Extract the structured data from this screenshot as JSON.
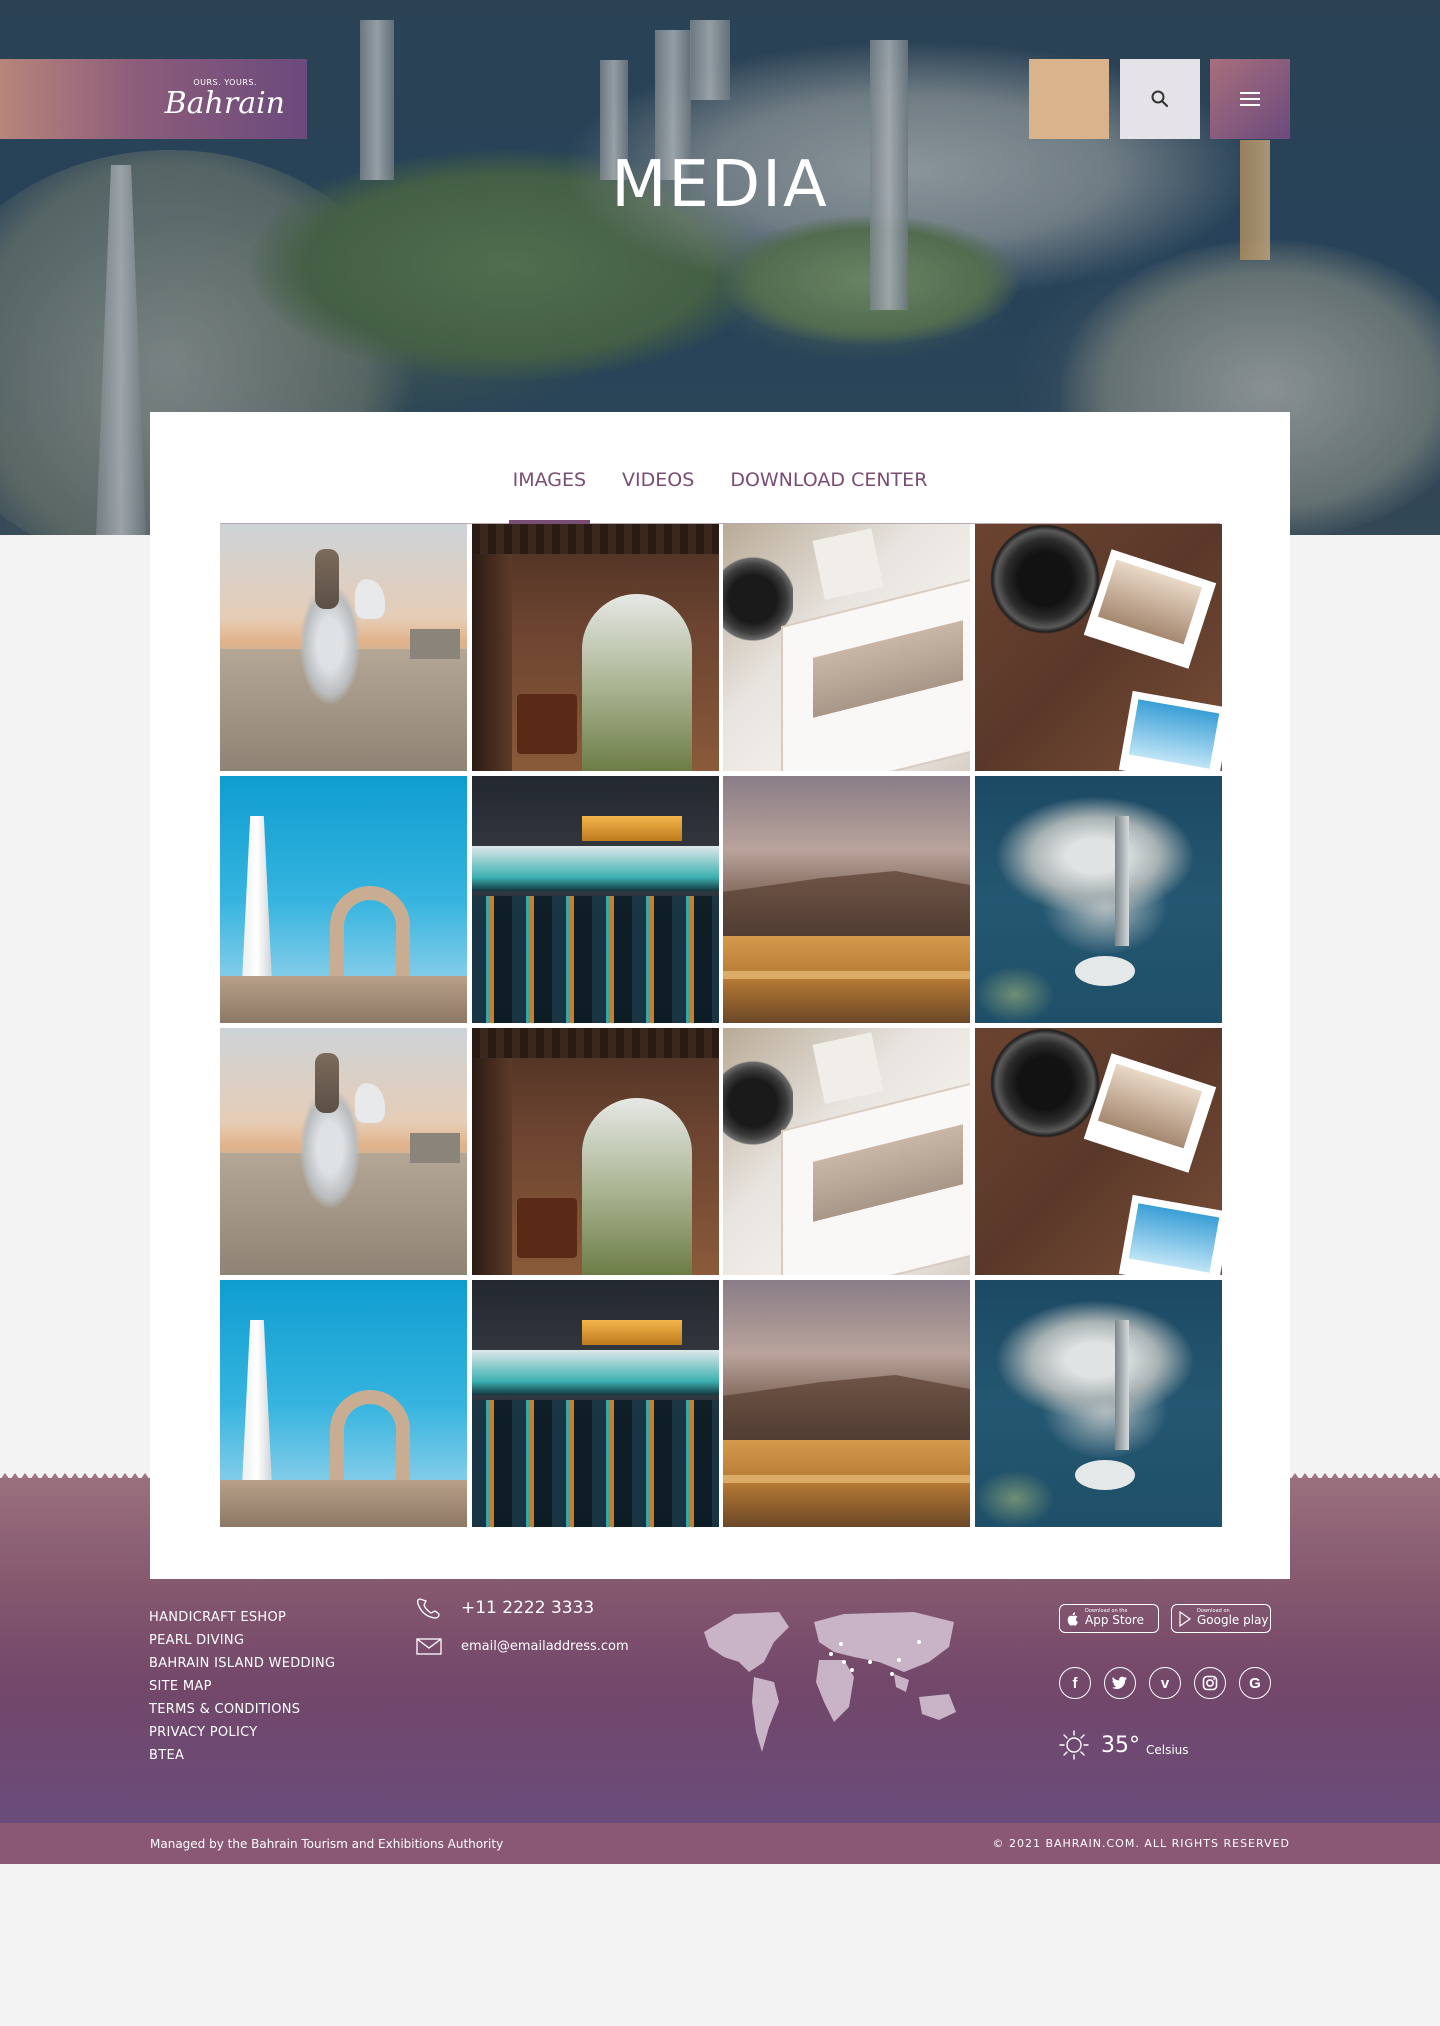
{
  "header": {
    "logo_tagline": "OURS. YOURS.",
    "logo_name": "Bahrain",
    "search_icon": "search-icon",
    "menu_icon": "menu-icon"
  },
  "hero": {
    "title": "MEDIA"
  },
  "tabs": [
    {
      "label": "IMAGES",
      "active": true
    },
    {
      "label": "VIDEOS",
      "active": false
    },
    {
      "label": "DOWNLOAD CENTER",
      "active": false
    }
  ],
  "gallery": [
    "horse-rider-beach",
    "arched-doorway",
    "camera-notebook",
    "camera-photographs",
    "minaret-ruins",
    "night-building-reflection",
    "fort-dusk",
    "aerial-city",
    "horse-rider-beach",
    "arched-doorway",
    "camera-notebook",
    "camera-photographs",
    "minaret-ruins",
    "night-building-reflection",
    "fort-dusk",
    "aerial-city"
  ],
  "footer": {
    "links": [
      "HANDICRAFT ESHOP",
      "PEARL DIVING",
      "BAHRAIN ISLAND WEDDING",
      "SITE MAP",
      "TERMS & CONDITIONS",
      "PRIVACY POLICY",
      "BTEA"
    ],
    "phone": "+11 2222 3333",
    "email": "email@emailaddress.com",
    "app_store": {
      "small": "Download on the",
      "big": "App Store"
    },
    "google_play": {
      "small": "Download on",
      "big": "Google play"
    },
    "socials": [
      "facebook-icon",
      "twitter-icon",
      "vimeo-icon",
      "instagram-icon",
      "google-icon"
    ],
    "weather": {
      "temp": "35°",
      "unit": "Celsius"
    }
  },
  "bottom": {
    "managed_by": "Managed by the Bahrain Tourism and Exhibitions Authority",
    "copyright": "© 2021 BAHRAIN.COM. ALL RIGHTS RESERVED"
  },
  "colors": {
    "brand_purple": "#7a4d73",
    "brand_sand": "#d8b38c",
    "footer_bar": "#8a5874"
  }
}
